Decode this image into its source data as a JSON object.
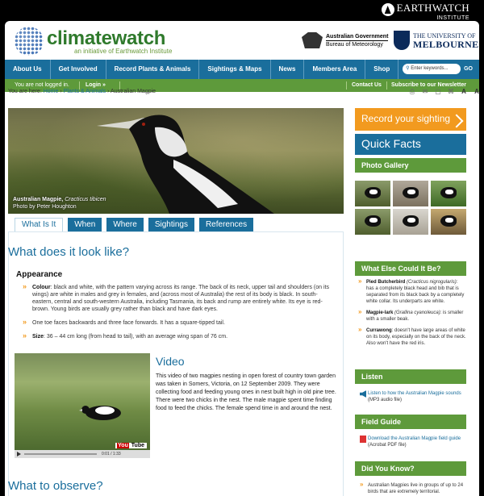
{
  "earthwatch": {
    "name": "EARTHWATCH",
    "sub": "INSTITUTE"
  },
  "header": {
    "brand": "climatewatch",
    "tagline": "an initiative of Earthwatch Institute",
    "gov_name": "Australian Government",
    "gov_sub": "Bureau of Meteorology",
    "uni_small": "THE UNIVERSITY OF",
    "uni_big": "MELBOURNE"
  },
  "nav": {
    "items": [
      "About Us",
      "Get Involved",
      "Record Plants & Animals",
      "Sightings & Maps",
      "News",
      "Members Area",
      "Shop"
    ],
    "search_placeholder": "Enter keywords...",
    "go": "GO"
  },
  "subnav": {
    "status": "You are not logged in.",
    "login": "Login »",
    "contact": "Contact Us",
    "subscribe": "Subscribe to our Newsletter"
  },
  "breadcrumb": {
    "prefix": "You are here:",
    "home": "Home",
    "section": "Plants & Animals",
    "current": "Australian Magpie"
  },
  "tools": [
    "print-icon",
    "email-icon",
    "comment-icon",
    "share-icon",
    "A",
    "A"
  ],
  "hero": {
    "name": "Australian Magpie,",
    "scientific": "Cracticus tibicen",
    "credit": "Photo by Peter Houghton"
  },
  "tabs": [
    "What Is It",
    "When",
    "Where",
    "Sightings",
    "References"
  ],
  "main": {
    "heading": "What does it look like?",
    "subheading": "Appearance",
    "bullets": [
      {
        "label": "Colour",
        "text": ": black and white, with the pattern varying across its range. The back of its neck, upper tail and shoulders (on its wings) are white in males and grey in females, and (across most of Australia) the rest of its body is black. In south-eastern, central and south-western Australia, including Tasmania, its back and rump are entirely white. Its eye is red-brown. Young birds are usually grey rather than black and have dark eyes."
      },
      {
        "label": "",
        "text": "One toe faces backwards and three face forwards. It has a square-tipped tail."
      },
      {
        "label": "Size",
        "text": ": 36 – 44 cm long (from head to tail), with an average wing span of 76 cm."
      }
    ],
    "video_title": "Video",
    "video_text": "This video of two magpies nesting in open forest of country town garden was taken in Somers, Victoria, on 12 September 2009. They were collecting food and feeding young ones in nest built high in old pine tree.  There were two chicks in the nest. The male magpie spent time finding food to feed the chicks. The female spend time in and around the nest.",
    "video_time": "0:01 / 1:33",
    "youtube": "You",
    "youtube2": "Tube",
    "observe_heading": "What to observe?"
  },
  "sidebar": {
    "record": "Record your sighting",
    "quick_facts": "Quick Facts",
    "gallery": "Photo Gallery",
    "else_title": "What Else Could It Be?",
    "else_items": [
      {
        "name": "Pied Butcherbird",
        "sci": "(Cracticus nigrogularis)",
        "text": ": has a completely black head and bib that is separated from its black back by a completely white collar. Its underparts are white."
      },
      {
        "name": "Magpie-lark",
        "sci": "(Grallina cyanoleuca)",
        "text": ": is smaller with a smaller beak."
      },
      {
        "name": "Currawong",
        "sci": "",
        "text": ": doesn't have large areas of white on its body, especially on the back of the neck. Also won't have the red iris."
      }
    ],
    "listen_title": "Listen",
    "listen_link": "Listen to how the Australian Magpie sounds",
    "listen_note": "(MP3 audio file)",
    "guide_title": "Field Guide",
    "guide_link": "Download the Australian Magpie field guide",
    "guide_note": "(Acrobat PDF file)",
    "dyk_title": "Did You Know?",
    "dyk_text": "Australian Magpies live in groups of up to 24 birds that are extremely territorial."
  }
}
